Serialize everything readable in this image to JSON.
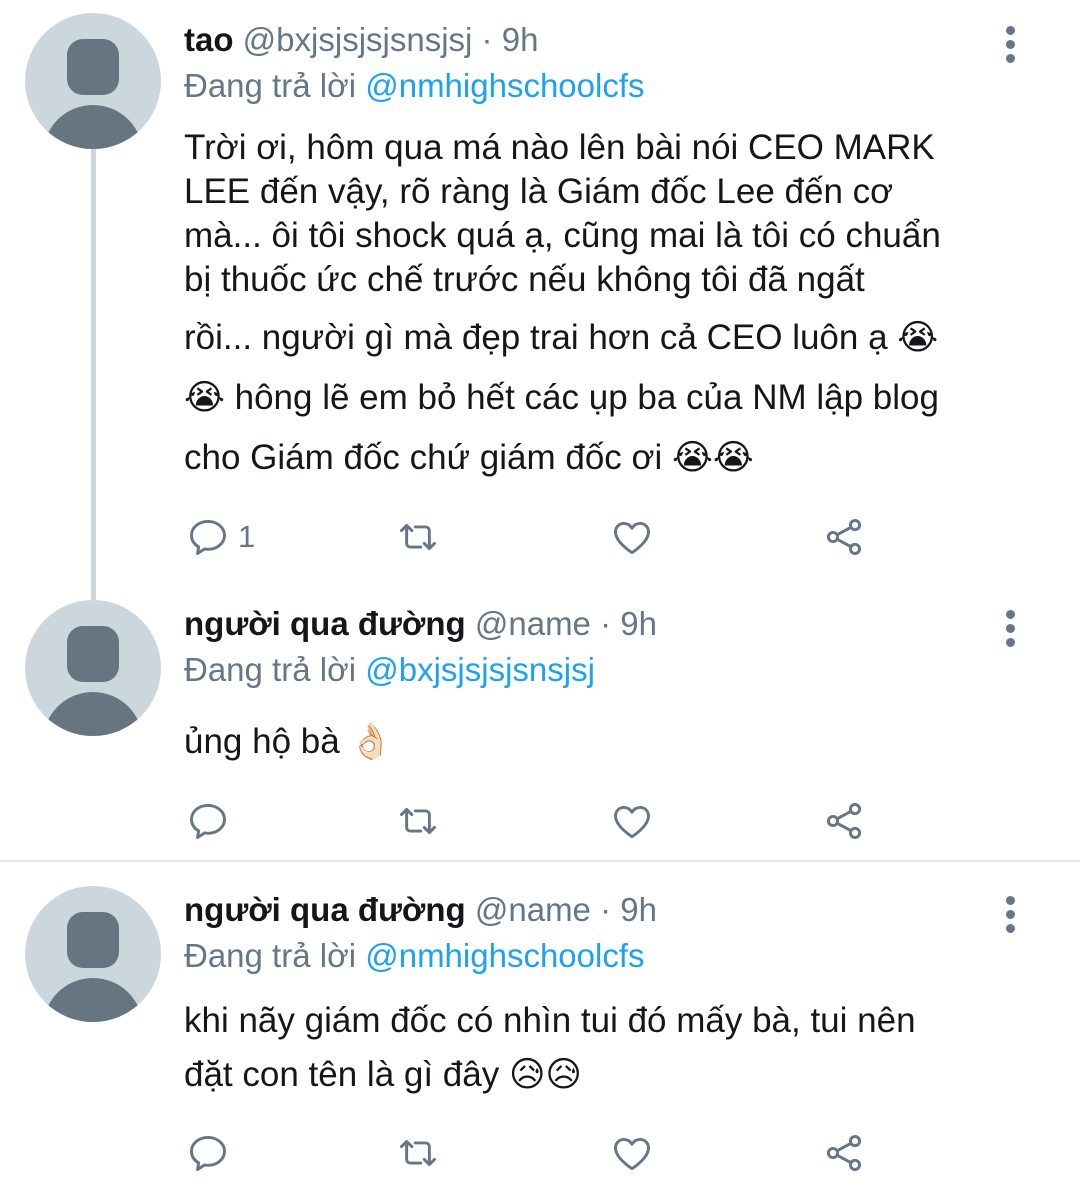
{
  "tweets": [
    {
      "name": "tao",
      "handle": "@bxjsjsjsjsnsjsj",
      "dot": "·",
      "time": "9h",
      "reply_prefix": "Đang trả lời",
      "reply_to": "@nmhighschoolcfs",
      "lines": [
        "Trời ơi, hôm qua má nào lên bài nói CEO MARK",
        "LEE đến vậy, rõ ràng là Giám đốc Lee đến cơ",
        "mà... ôi tôi shock quá ạ, cũng mai là tôi có chuẩn",
        "bị thuốc ức chế trước nếu không tôi đã ngất",
        "rồi... người gì mà đẹp trai hơn cả CEO luôn ạ 😭",
        "😭 hông lẽ em bỏ hết các ụp ba của NM lập blog",
        "cho Giám đốc chứ giám đốc ơi 😭😭"
      ],
      "reply_count": "1"
    },
    {
      "name": "người qua đường",
      "handle": "@name",
      "dot": "·",
      "time": "9h",
      "reply_prefix": "Đang trả lời",
      "reply_to": "@bxjsjsjsjsnsjsj",
      "lines": [
        "ủng hộ bà 👌🏻"
      ],
      "reply_count": ""
    },
    {
      "name": "người qua đường",
      "handle": "@name",
      "dot": "·",
      "time": "9h",
      "reply_prefix": "Đang trả lời",
      "reply_to": "@nmhighschoolcfs",
      "lines": [
        "khi nãy giám đốc có nhìn tui đó mấy bà, tui nên",
        "đặt con tên là gì đây 😥😥"
      ],
      "reply_count": ""
    }
  ],
  "icons": {
    "reply": "reply-icon",
    "retweet": "retweet-icon",
    "like": "heart-icon",
    "share": "share-icon",
    "more": "more-vertical-icon"
  },
  "colors": {
    "text": "#14171a",
    "secondary": "#657786",
    "link": "#1da1f2",
    "avatar_bg": "#ccd6dd",
    "avatar_fg": "#66757f",
    "divider": "#e1e8ed"
  }
}
